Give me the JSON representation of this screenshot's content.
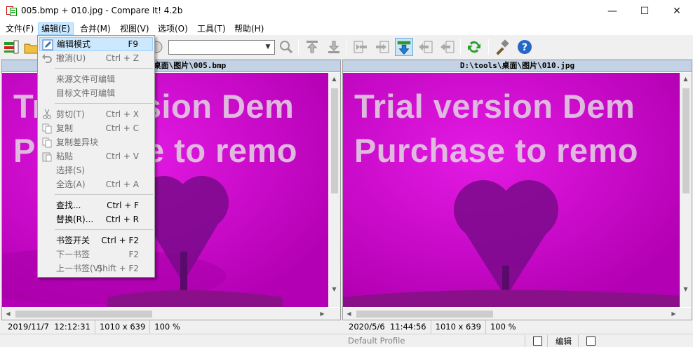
{
  "window": {
    "title": "005.bmp + 010.jpg - Compare It! 4.2b",
    "minimize_glyph": "—",
    "maximize_glyph": "☐",
    "close_glyph": "✕"
  },
  "menubar": [
    {
      "label": "文件(F)",
      "active": false
    },
    {
      "label": "编辑(E)",
      "active": true
    },
    {
      "label": "合并(M)",
      "active": false
    },
    {
      "label": "视图(V)",
      "active": false
    },
    {
      "label": "选项(O)",
      "active": false
    },
    {
      "label": "工具(T)",
      "active": false
    },
    {
      "label": "帮助(H)",
      "active": false
    }
  ],
  "toolbar": {
    "filter_value": "",
    "icons": [
      "compare-icon",
      "open-folder-icon",
      "search-icon",
      "first-diff-icon",
      "last-diff-icon",
      "copy-left-to-right-icon",
      "copy-right-to-left-icon",
      "sync-scroll-icon",
      "prev-diff-icon",
      "next-diff-icon",
      "refresh-icon",
      "tools-icon",
      "help-icon"
    ]
  },
  "edit_menu": {
    "items": [
      {
        "label": "编辑模式",
        "shortcut": "F9",
        "enabled": true,
        "highlighted": true,
        "icon": "edit-pencil-icon"
      },
      {
        "label": "撤消(U)",
        "shortcut": "Ctrl + Z",
        "enabled": false,
        "icon": "undo-icon"
      },
      {
        "separator": true
      },
      {
        "label": "来源文件可编辑",
        "shortcut": "",
        "enabled": false
      },
      {
        "label": "目标文件可编辑",
        "shortcut": "",
        "enabled": false
      },
      {
        "separator": true
      },
      {
        "label": "剪切(T)",
        "shortcut": "Ctrl + X",
        "enabled": false,
        "icon": "cut-icon"
      },
      {
        "label": "复制",
        "shortcut": "Ctrl + C",
        "enabled": false,
        "icon": "copy-icon"
      },
      {
        "label": "复制差异块",
        "shortcut": "",
        "enabled": false,
        "icon": "copy-block-icon"
      },
      {
        "label": "粘贴",
        "shortcut": "Ctrl + V",
        "enabled": false,
        "icon": "paste-icon"
      },
      {
        "label": "选择(S)",
        "shortcut": "",
        "enabled": false
      },
      {
        "label": "全选(A)",
        "shortcut": "Ctrl + A",
        "enabled": false
      },
      {
        "separator": true
      },
      {
        "label": "查找...",
        "shortcut": "Ctrl + F",
        "enabled": true
      },
      {
        "label": "替换(R)...",
        "shortcut": "Ctrl + R",
        "enabled": true
      },
      {
        "separator": true
      },
      {
        "label": "书签开关",
        "shortcut": "Ctrl + F2",
        "enabled": true
      },
      {
        "label": "下一书签",
        "shortcut": "F2",
        "enabled": false
      },
      {
        "label": "上一书签(V)",
        "shortcut": "Shift + F2",
        "enabled": false
      }
    ]
  },
  "left_pane": {
    "header": ":\\tools\\桌面\\图片\\005.bmp",
    "watermark_line1": "Trial version Dem",
    "watermark_line2": "Purchase to remo",
    "date": "2019/11/7",
    "time": "12:12:31",
    "dimensions": "1010 x 639",
    "zoom": "100 %"
  },
  "right_pane": {
    "header": "D:\\tools\\桌面\\图片\\010.jpg",
    "watermark_line1": "Trial version Dem",
    "watermark_line2": "Purchase to remo",
    "date": "2020/5/6",
    "time": "11:44:56",
    "dimensions": "1010 x 639",
    "zoom": "100 %"
  },
  "statusbar": {
    "profile": "Default Profile",
    "edit_mode_label": "编辑"
  },
  "colors": {
    "image_magenta": "#d400d4",
    "tree_purple": "#7a0a8a",
    "header_blue": "#c3d2e4",
    "menu_highlight": "#cce8ff"
  }
}
